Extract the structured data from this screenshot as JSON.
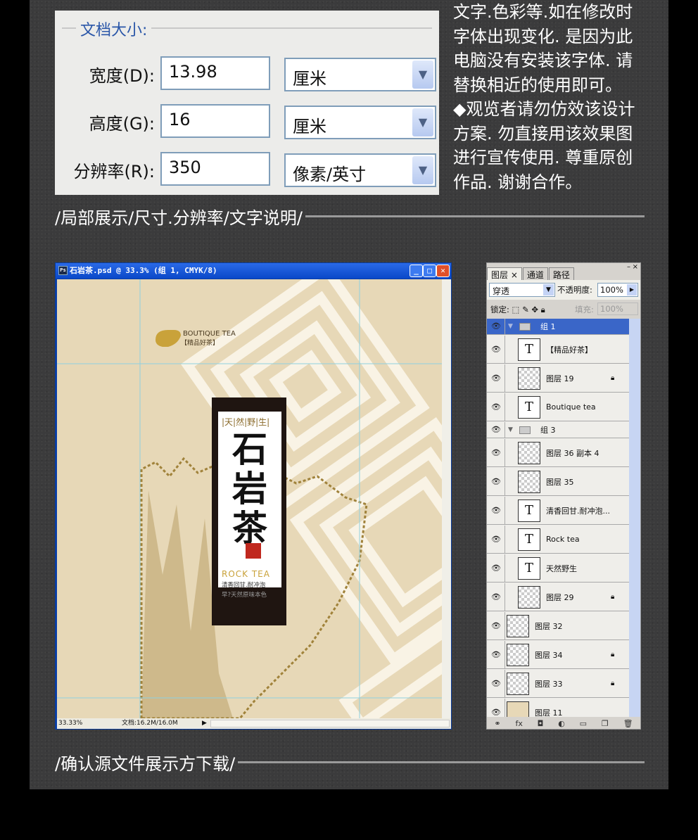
{
  "dialog": {
    "title": "文档大小:",
    "rows": [
      {
        "label": "宽度(D):",
        "value": "13.98",
        "unit": "厘米"
      },
      {
        "label": "高度(G):",
        "value": "16",
        "unit": "厘米"
      },
      {
        "label": "分辨率(R):",
        "value": "350",
        "unit": "像素/英寸"
      }
    ]
  },
  "note_lines": [
    "文字.色彩等.如在修改时",
    "字体出现变化. 是因为此",
    "电脑没有安装该字体. 请",
    "替换相近的使用即可。",
    "◆观览者请勿仿效该设计",
    "方案. 勿直接用该效果图",
    "进行宣传使用. 尊重原创",
    "作品. 谢谢合作。"
  ],
  "caption1": "/局部展示/尺寸.分辨率/文字说明/",
  "caption2": "/确认源文件展示方下载/",
  "ps_window": {
    "title": "石岩茶.psd @ 33.3% (组 1, CMYK/8)",
    "zoom": "33.33%",
    "doc": "文档:16.2M/16.0M",
    "art": {
      "brand_en": "BOUTIQUE TEA",
      "brand_cn": "【精品好茶】",
      "tag": "|天|然|野|生|",
      "name_chars": [
        "石",
        "岩",
        "茶"
      ],
      "rock": "ROCK TEA",
      "line1": "清香回甘.耐冲泡",
      "line2": "早?天然原味本色"
    },
    "colors": {
      "canvas": "#e7d8b7",
      "gold": "#a0823a",
      "titlebar": "#0a48c8"
    }
  },
  "layers": {
    "tabs": [
      "图层 ×",
      "通道",
      "路径"
    ],
    "blend": "穿透",
    "opacity_label": "不透明度:",
    "opacity": "100%",
    "lock_label": "锁定:",
    "fill_label": "填充:",
    "fill": "100%",
    "items": [
      {
        "name": "组 1",
        "type": "group",
        "selected": true
      },
      {
        "name": "【精品好茶】",
        "type": "text"
      },
      {
        "name": "图层 19",
        "type": "pixel",
        "locked": true
      },
      {
        "name": "Boutique tea",
        "type": "text"
      },
      {
        "name": "组 3",
        "type": "group"
      },
      {
        "name": "图层 36 副本 4",
        "type": "pixel"
      },
      {
        "name": "图层 35",
        "type": "pixel"
      },
      {
        "name": "清香回甘.耐冲泡...",
        "type": "text"
      },
      {
        "name": "Rock tea",
        "type": "text"
      },
      {
        "name": "天然野生",
        "type": "text"
      },
      {
        "name": "图层 29",
        "type": "pixel",
        "locked": true
      },
      {
        "name": "图层 32",
        "type": "pixel",
        "top": true
      },
      {
        "name": "图层 34",
        "type": "pixel",
        "top": true,
        "locked": true
      },
      {
        "name": "图层 33",
        "type": "pixel",
        "top": true,
        "locked": true
      },
      {
        "name": "图层 11",
        "type": "fill",
        "top": true
      }
    ],
    "bottom_icons": [
      "link-icon",
      "fx-icon",
      "mask-icon",
      "adjustment-icon",
      "folder-icon",
      "new-layer-icon",
      "trash-icon"
    ]
  }
}
